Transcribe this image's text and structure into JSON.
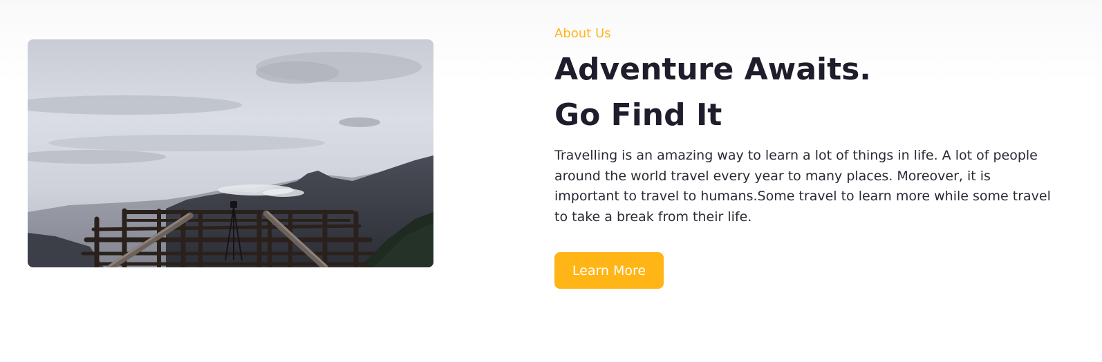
{
  "about_section": {
    "eyebrow": "About Us",
    "headline_line1": "Adventure Awaits.",
    "headline_line2": "Go Find It",
    "paragraph": "Travelling is an amazing way to learn a lot of things in life. A lot of people around the world travel every year to many places. Moreover, it is important to travel to humans.Some travel to learn more while some travel to take a break from their life.",
    "cta_label": "Learn More"
  },
  "colors": {
    "accent": "#ffb515",
    "heading": "#1f1d2b",
    "body_text": "#2b2a35",
    "button_text": "#ffffff"
  },
  "media": {
    "photo_subject": "mountain-viewpoint-photo"
  }
}
